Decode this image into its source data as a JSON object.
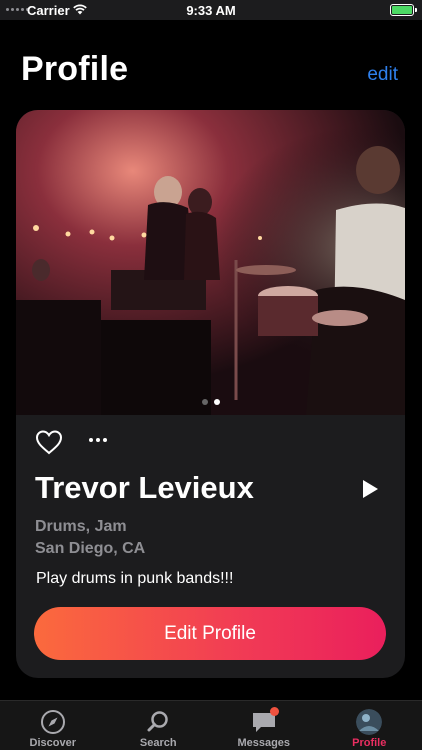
{
  "status_bar": {
    "carrier": "Carrier",
    "time": "9:33 AM",
    "battery_color": "#4cd964"
  },
  "header": {
    "title": "Profile",
    "edit_label": "edit",
    "accent_color": "#2f80ed"
  },
  "profile": {
    "photo_pages": 2,
    "photo_active_page": 2,
    "name": "Trevor Levieux",
    "instruments": "Drums, Jam",
    "location": "San Diego,  CA",
    "bio": "Play drums in punk bands!!!",
    "edit_button_label": "Edit Profile",
    "icons": {
      "like": "heart-icon",
      "more": "ellipsis-icon",
      "play": "play-icon"
    }
  },
  "tab_bar": {
    "tabs": [
      {
        "label": "Discover",
        "icon": "compass-icon",
        "active": false
      },
      {
        "label": "Search",
        "icon": "search-icon",
        "active": false
      },
      {
        "label": "Messages",
        "icon": "chat-bubble-icon",
        "active": false,
        "badge": true
      },
      {
        "label": "Profile",
        "icon": "avatar",
        "active": true
      }
    ],
    "active_color": "#ea2e61"
  }
}
